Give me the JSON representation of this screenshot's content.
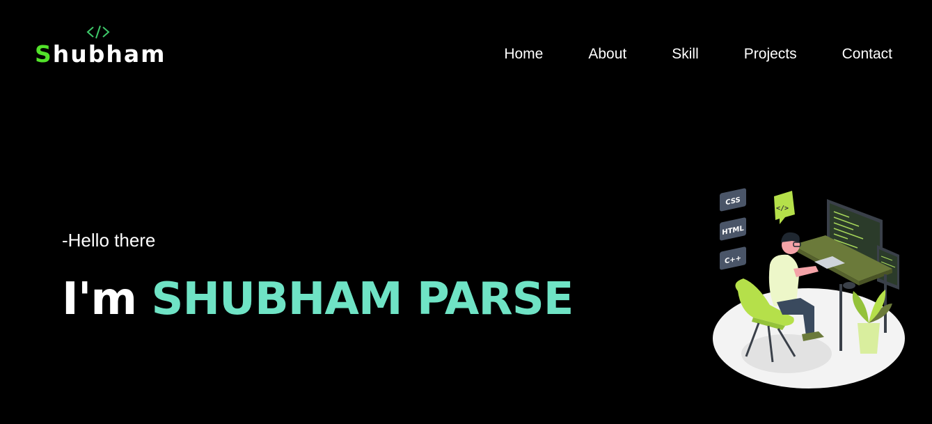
{
  "logo": {
    "first_letter": "S",
    "rest": "hubham",
    "icon": "code-brackets-icon",
    "accent_color": "#52e22a"
  },
  "nav": {
    "items": [
      {
        "label": "Home"
      },
      {
        "label": "About"
      },
      {
        "label": "Skill"
      },
      {
        "label": "Projects"
      },
      {
        "label": "Contact"
      }
    ]
  },
  "hero": {
    "greeting": "-Hello there",
    "prefix": "I'm",
    "name": "SHUBHAM PARSE",
    "name_color": "#6fe3c5"
  },
  "illustration": {
    "tags": [
      "CSS",
      "HTML",
      "C++"
    ],
    "icon": "developer-at-desk-illustration"
  }
}
